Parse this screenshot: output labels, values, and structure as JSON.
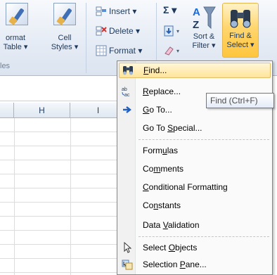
{
  "ribbon": {
    "format_table": {
      "line1": "ormat",
      "line2": "Table ▾"
    },
    "cell_styles": {
      "line1": "Cell",
      "line2": "Styles ▾"
    },
    "styles_group_label": "les",
    "cells_group_label": "Ce",
    "insert_label": "Insert ▾",
    "delete_label": "Delete ▾",
    "format_label": "Format ▾",
    "sum_symbol": "Σ ▾",
    "sort_filter": {
      "line1": "Sort &",
      "line2": "Filter ▾"
    },
    "find_select": {
      "line1": "Find &",
      "line2": "Select ▾"
    }
  },
  "grid": {
    "columns": [
      "H",
      "I"
    ]
  },
  "menu": {
    "items": [
      {
        "pre": "",
        "u": "F",
        "post": "ind...",
        "icon": "binoculars-icon",
        "highlighted": true
      },
      {
        "pre": "",
        "u": "R",
        "post": "eplace...",
        "icon": "replace-icon"
      },
      {
        "pre": "",
        "u": "G",
        "post": "o To...",
        "icon": "arrow-right-icon"
      },
      {
        "pre": "Go To ",
        "u": "S",
        "post": "pecial..."
      },
      {
        "pre": "Form",
        "u": "u",
        "post": "las"
      },
      {
        "pre": "Co",
        "u": "m",
        "post": "ments"
      },
      {
        "pre": "",
        "u": "C",
        "post": "onditional Formatting"
      },
      {
        "pre": "Co",
        "u": "n",
        "post": "stants"
      },
      {
        "pre": "Data ",
        "u": "V",
        "post": "alidation"
      },
      {
        "pre": "Select ",
        "u": "O",
        "post": "bjects",
        "icon": "pointer-icon"
      },
      {
        "pre": "Selection ",
        "u": "P",
        "post": "ane...",
        "icon": "selection-pane-icon"
      }
    ]
  },
  "tooltip": {
    "text": "Find (Ctrl+F)"
  }
}
